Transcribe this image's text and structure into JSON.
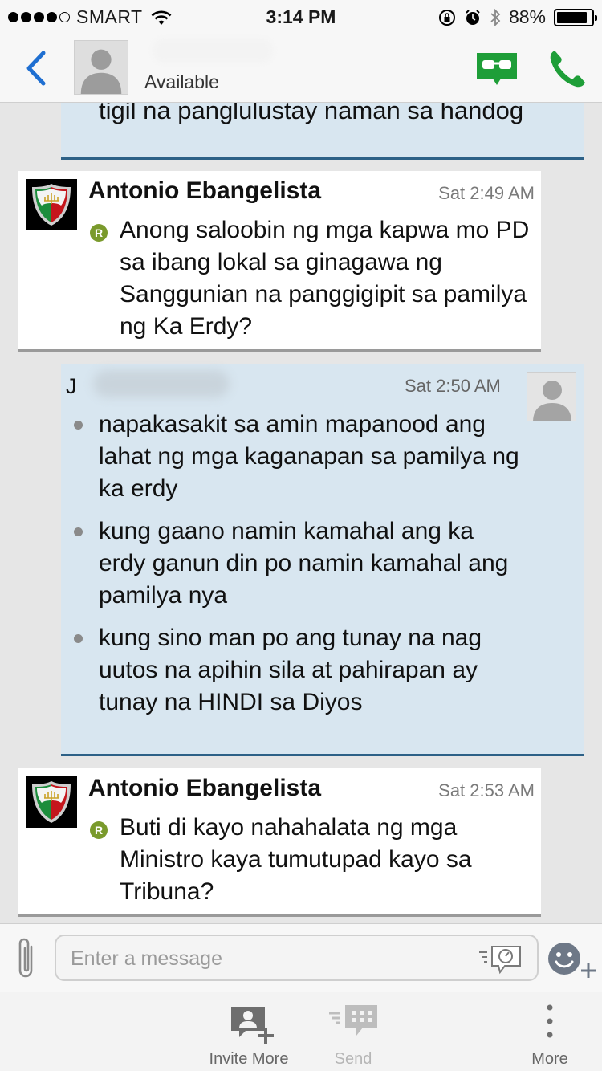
{
  "status_bar": {
    "carrier": "SMART",
    "time": "3:14 PM",
    "battery": "88%",
    "battery_level": 0.88,
    "signal_bars_filled": 4,
    "signal_bars_total": 5
  },
  "header": {
    "status": "Available",
    "accent_color": "#1e9e38",
    "back_color": "#1f6fd1"
  },
  "messages": [
    {
      "direction": "outgoing",
      "text": "tigil na panglulustay naman sa handog"
    },
    {
      "direction": "incoming",
      "sender": "Antonio Ebangelista",
      "time": "Sat 2:49 AM",
      "read_badge": "R",
      "text": "Anong saloobin ng mga kapwa mo PD sa ibang lokal sa ginagawa ng Sanggunian na panggigipit sa pamilya ng Ka Erdy?"
    },
    {
      "direction": "outgoing",
      "sender_initial": "J",
      "time": "Sat 2:50 AM",
      "bullets": [
        "napakasakit sa amin mapanood ang lahat ng mga kaganapan sa pamilya ng ka erdy",
        "kung gaano namin kamahal ang ka erdy ganun din po namin kamahal ang pamilya nya",
        "kung sino man po ang tunay na nag uutos na apihin sila at pahirapan ay tunay na HINDI sa Diyos"
      ]
    },
    {
      "direction": "incoming",
      "sender": "Antonio Ebangelista",
      "time": "Sat 2:53 AM",
      "read_badge": "R",
      "text": "Buti di kayo nahahalata ng mga Ministro kaya tumutupad kayo sa Tribuna?"
    }
  ],
  "compose": {
    "placeholder": "Enter a message"
  },
  "toolbar": {
    "invite": "Invite More",
    "send": "Send",
    "more": "More"
  }
}
